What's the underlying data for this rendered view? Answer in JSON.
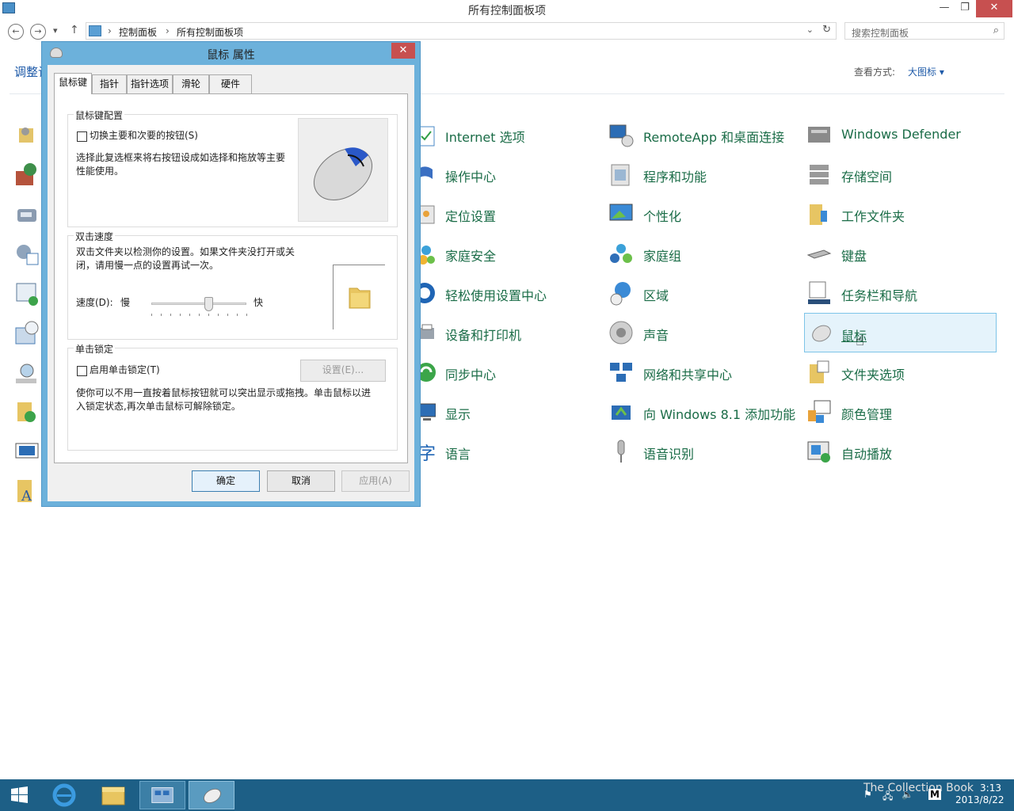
{
  "window": {
    "title": "所有控制面板项",
    "min_label": "—",
    "max_label": "❐",
    "close_label": "✕"
  },
  "address": {
    "back": "←",
    "forward": "→",
    "history": "▾",
    "up": "↑",
    "crumbs": [
      "控制面板",
      "所有控制面板项"
    ],
    "sep": "›",
    "dropdown": "⌄",
    "refresh": "↻",
    "search_placeholder": "搜索控制面板",
    "search_icon": "⌕"
  },
  "header": {
    "title_partial": "调整计",
    "view_label": "查看方式:",
    "view_value": "大图标 ▾"
  },
  "items": {
    "col1": [
      "Internet 选项",
      "操作中心",
      "定位设置",
      "家庭安全",
      "轻松使用设置中心",
      "设备和打印机",
      "同步中心",
      "显示",
      "语言"
    ],
    "col2": [
      "RemoteApp 和桌面连接",
      "程序和功能",
      "个性化",
      "家庭组",
      "区域",
      "声音",
      "网络和共享中心",
      "向 Windows 8.1 添加功能",
      "语音识别"
    ],
    "col3": [
      "Windows Defender",
      "存储空间",
      "工作文件夹",
      "键盘",
      "任务栏和导航",
      "鼠标",
      "文件夹选项",
      "颜色管理",
      "自动播放"
    ]
  },
  "dialog": {
    "title": "鼠标 属性",
    "close": "✕",
    "tabs": [
      "鼠标键",
      "指针",
      "指针选项",
      "滑轮",
      "硬件"
    ],
    "group1_title": "鼠标键配置",
    "switch_label": "切换主要和次要的按钮(S)",
    "switch_desc": "选择此复选框来将右按钮设成如选择和拖放等主要性能使用。",
    "group2_title": "双击速度",
    "dbl_desc": "双击文件夹以检测你的设置。如果文件夹没打开或关闭，请用慢一点的设置再试一次。",
    "speed_label": "速度(D):",
    "slow": "慢",
    "fast": "快",
    "speed_value": 0.6,
    "group3_title": "单击锁定",
    "clicklock_label": "启用单击锁定(T)",
    "settings_btn": "设置(E)...",
    "clicklock_desc": "使你可以不用一直按着鼠标按钮就可以突出显示或拖拽。单击鼠标以进入锁定状态,再次单击鼠标可解除锁定。",
    "ok": "确定",
    "cancel": "取消",
    "apply": "应用(A)"
  },
  "taskbar": {
    "watermark": "The Collection Book",
    "tray_ime": "M",
    "time": "3:13",
    "date": "2013/8/22"
  },
  "colors": {
    "link": "#1a6c47",
    "accent": "#1e5aa8",
    "dialog_frame": "#6cb1db",
    "taskbar": "#1d5f86",
    "close": "#c75050"
  }
}
